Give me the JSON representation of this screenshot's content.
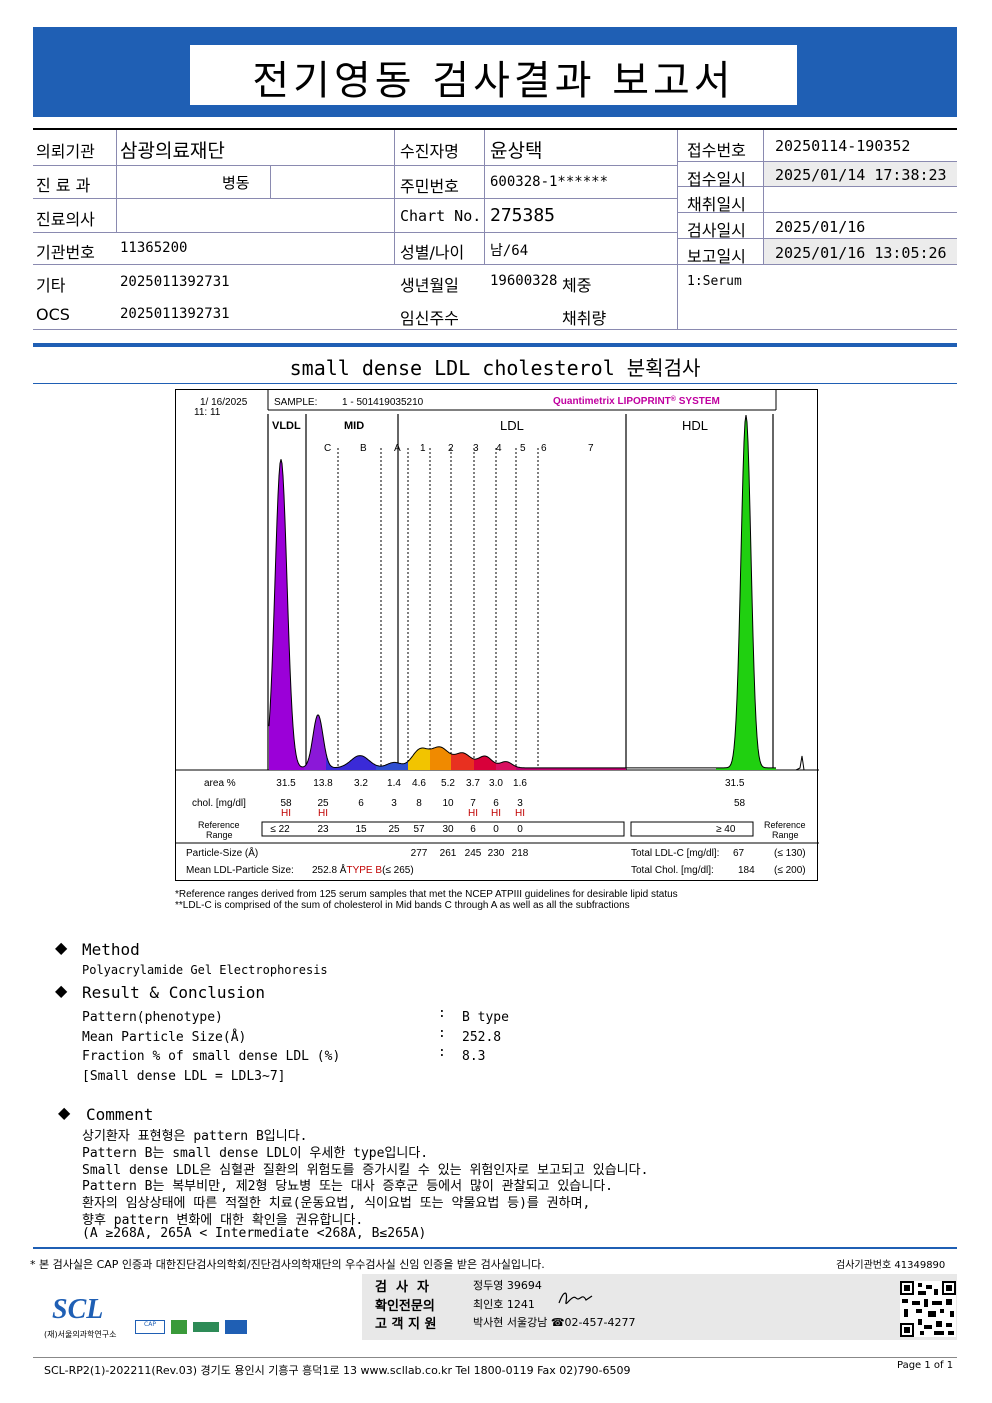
{
  "header": {
    "title": "전기영동 검사결과 보고서"
  },
  "info": {
    "institution_label": "의뢰기관",
    "institution": "삼광의료재단",
    "dept_label": "진 료 과",
    "dept": "병동",
    "doctor_label": "진료의사",
    "code_label": "기관번호",
    "code": "11365200",
    "etc_label": "기타",
    "etc": "2025011392731",
    "ocs_label": "OCS",
    "ocs": "2025011392731",
    "patient_label": "수진자명",
    "patient": "윤상택",
    "rrn_label": "주민번호",
    "rrn": "600328-1******",
    "chart_label": "Chart No.",
    "chart_no": "275385",
    "sexage_label": "성별/나이",
    "sexage": "남/64",
    "birth_label": "생년월일",
    "birth": "19600328",
    "weight_label": "체중",
    "preg_label": "임신주수",
    "volume_label": "채취량",
    "accession_label": "접수번호",
    "accession": "20250114-190352",
    "received_label": "접수일시",
    "received": "2025/01/14 17:38:23",
    "collected_label": "채취일시",
    "collected": "",
    "tested_label": "검사일시",
    "tested": "2025/01/16",
    "reported_label": "보고일시",
    "reported": "2025/01/16 13:05:26",
    "specimen": "1:Serum"
  },
  "subtitle": "small dense LDL cholesterol 분획검사",
  "chart": {
    "date": "1/ 16/2025",
    "time": "11: 11",
    "sample_label": "SAMPLE:",
    "sample": "1 - 501419035210",
    "brand": "Quantimetrix LIPOPRINT",
    "brand_system": "SYSTEM",
    "groups": {
      "vldl": "VLDL",
      "mid": "MID",
      "ldl": "LDL",
      "hdl": "HDL"
    },
    "bands": [
      "C",
      "B",
      "A",
      "1",
      "2",
      "3",
      "4",
      "5",
      "6",
      "7"
    ],
    "row_area_label": "area %",
    "row_chol_label": "chol. [mg/dl]",
    "row_ref_label_1": "Reference",
    "row_ref_label_2": "Range",
    "hi": "HI",
    "area": [
      "31.5",
      "13.8",
      "3.2",
      "1.4",
      "4.6",
      "5.2",
      "3.7",
      "3.0",
      "1.6"
    ],
    "area_hdl": "31.5",
    "chol": [
      "58",
      "25",
      "6",
      "3",
      "8",
      "10",
      "7",
      "6",
      "3"
    ],
    "chol_hdl": "58",
    "ref": [
      "≤ 22",
      "23",
      "15",
      "25",
      "57",
      "30",
      "6",
      "0",
      "0"
    ],
    "ref_hdl": "≥  40",
    "ref_right_1": "Reference",
    "ref_right_2": "Range",
    "particle_label": "Particle-Size (Å)",
    "particle": [
      "277",
      "261",
      "245",
      "230",
      "218"
    ],
    "mean_label": "Mean LDL-Particle Size:",
    "mean_value": "252.8 Å",
    "mean_type": "TYPE B",
    "mean_ref": "(≤ 265)",
    "total_ldl_label": "Total LDL-C [mg/dl]:",
    "total_ldl": "67",
    "total_ldl_ref": "(≤ 130)",
    "total_chol_label": "Total Chol. [mg/dl]:",
    "total_chol": "184",
    "total_chol_ref": "(≤ 200)"
  },
  "chart_data": {
    "type": "area",
    "title": "",
    "x": [
      "VLDL",
      "C",
      "B",
      "A",
      "1",
      "2",
      "3",
      "4",
      "5",
      "6",
      "7",
      "HDL"
    ],
    "series": [
      {
        "name": "area %",
        "values": [
          31.5,
          13.8,
          3.2,
          1.4,
          4.6,
          5.2,
          3.7,
          3.0,
          1.6,
          0,
          0,
          31.5
        ]
      },
      {
        "name": "chol. [mg/dl]",
        "values": [
          58,
          25,
          6,
          3,
          8,
          10,
          7,
          6,
          3,
          0,
          0,
          58
        ]
      }
    ]
  },
  "notes": {
    "n1": "*Reference ranges derived from 125 serum samples that met the NCEP ATPIII guidelines for desirable lipid status",
    "n2": "**LDL-C is comprised of the sum of cholesterol in Mid bands C through A as well as all the subfractions"
  },
  "method": {
    "title": "Method",
    "text": "Polyacrylamide Gel Electrophoresis"
  },
  "result": {
    "title": "Result & Conclusion",
    "rows": [
      {
        "label": "Pattern(phenotype)",
        "value": "B type"
      },
      {
        "label": "Mean Particle Size(Å)",
        "value": "252.8"
      },
      {
        "label": "Fraction % of small dense LDL (%)",
        "value": "8.3"
      }
    ],
    "note": "[Small dense LDL = LDL3~7]"
  },
  "comment": {
    "title": "Comment",
    "lines": [
      "상기환자 표현형은 pattern B입니다.",
      "Pattern B는 small dense LDL이 우세한 type입니다.",
      "Small dense LDL은 심혈관 질환의 위험도를 증가시킬 수 있는 위험인자로 보고되고 있습니다.",
      "Pattern B는 복부비만, 제2형 당뇨병 또는 대사 증후군 등에서 많이 관찰되고 있습니다.",
      "환자의 임상상태에 따른 적절한 치료(운동요법, 식이요법 또는 약물요법 등)를 권하며,",
      "향후 pattern 변화에 대한 확인을 권유합니다.",
      "(A ≥268A, 265A < Intermediate <268A, B≤265A)"
    ]
  },
  "footer": {
    "cert": "* 본 검사실은 CAP 인증과 대한진단검사의학회/진단검사의학재단의 우수검사실 신임 인증을 받은 검사실입니다.",
    "lab_no": "검사기관번호 41349890",
    "tester_label": "검  사  자",
    "tester": "정두영 39694",
    "confirm_label": "확인전문의",
    "confirm": "최인호 1241",
    "support_label": "고 객 지 원",
    "support": "박사현 서울강남 ☎02-457-4277",
    "logo": "SCL",
    "logo_sub": "(재)서울의과학연구소",
    "bottom": "SCL-RP2(1)-202211(Rev.03)  경기도 용인시 기흥구 흥덕1로 13  www.scllab.co.kr   Tel 1800-0119   Fax 02)790-6509",
    "page": "Page 1 of 1"
  }
}
